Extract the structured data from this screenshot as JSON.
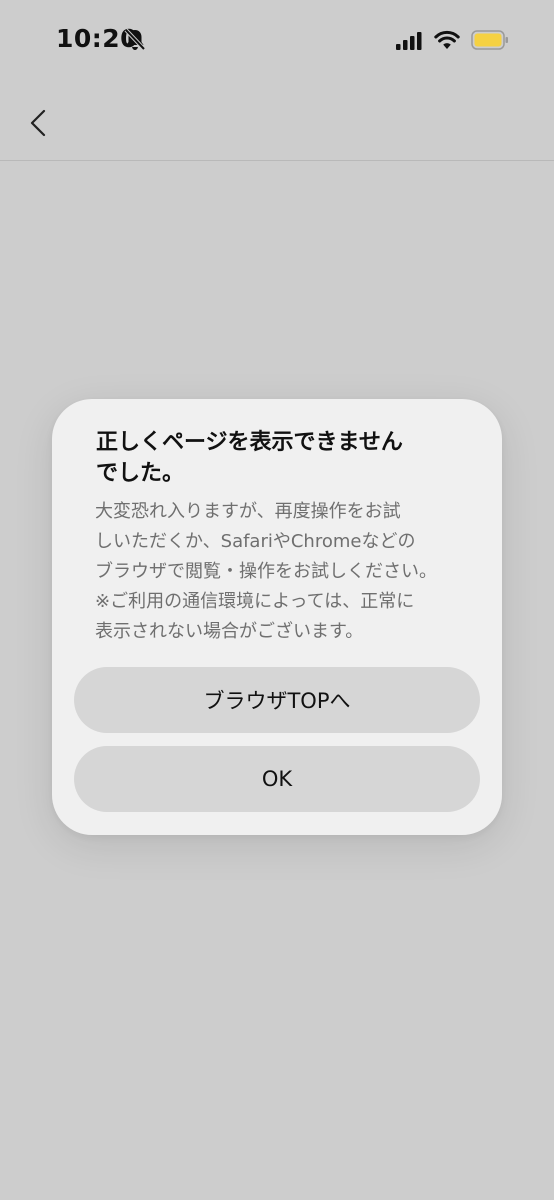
{
  "status_bar": {
    "time": "10:20",
    "icons": [
      "bell-slash-icon",
      "cellular-signal-icon",
      "wifi-icon",
      "battery-icon"
    ],
    "battery_color": "#f5d142"
  },
  "header": {
    "back_icon": "chevron-left-icon"
  },
  "dialog": {
    "title_line1": "正しくページを表示できません",
    "title_line2": "でした。",
    "message_lines": [
      "大変恐れ入りますが、再度操作をお試",
      "しいただくか、SafariやChromeなどの",
      "ブラウザで閲覧・操作をお試しください。",
      "※ご利用の通信環境によっては、正常に",
      "表示されない場合がございます。"
    ],
    "browser_top_label": "ブラウザTOPへ",
    "ok_label": "OK"
  },
  "colors": {
    "background": "#cdcdcd",
    "dialog": "#f0f0f0",
    "button": "#d6d6d6",
    "message_text": "#6f6f6f"
  }
}
